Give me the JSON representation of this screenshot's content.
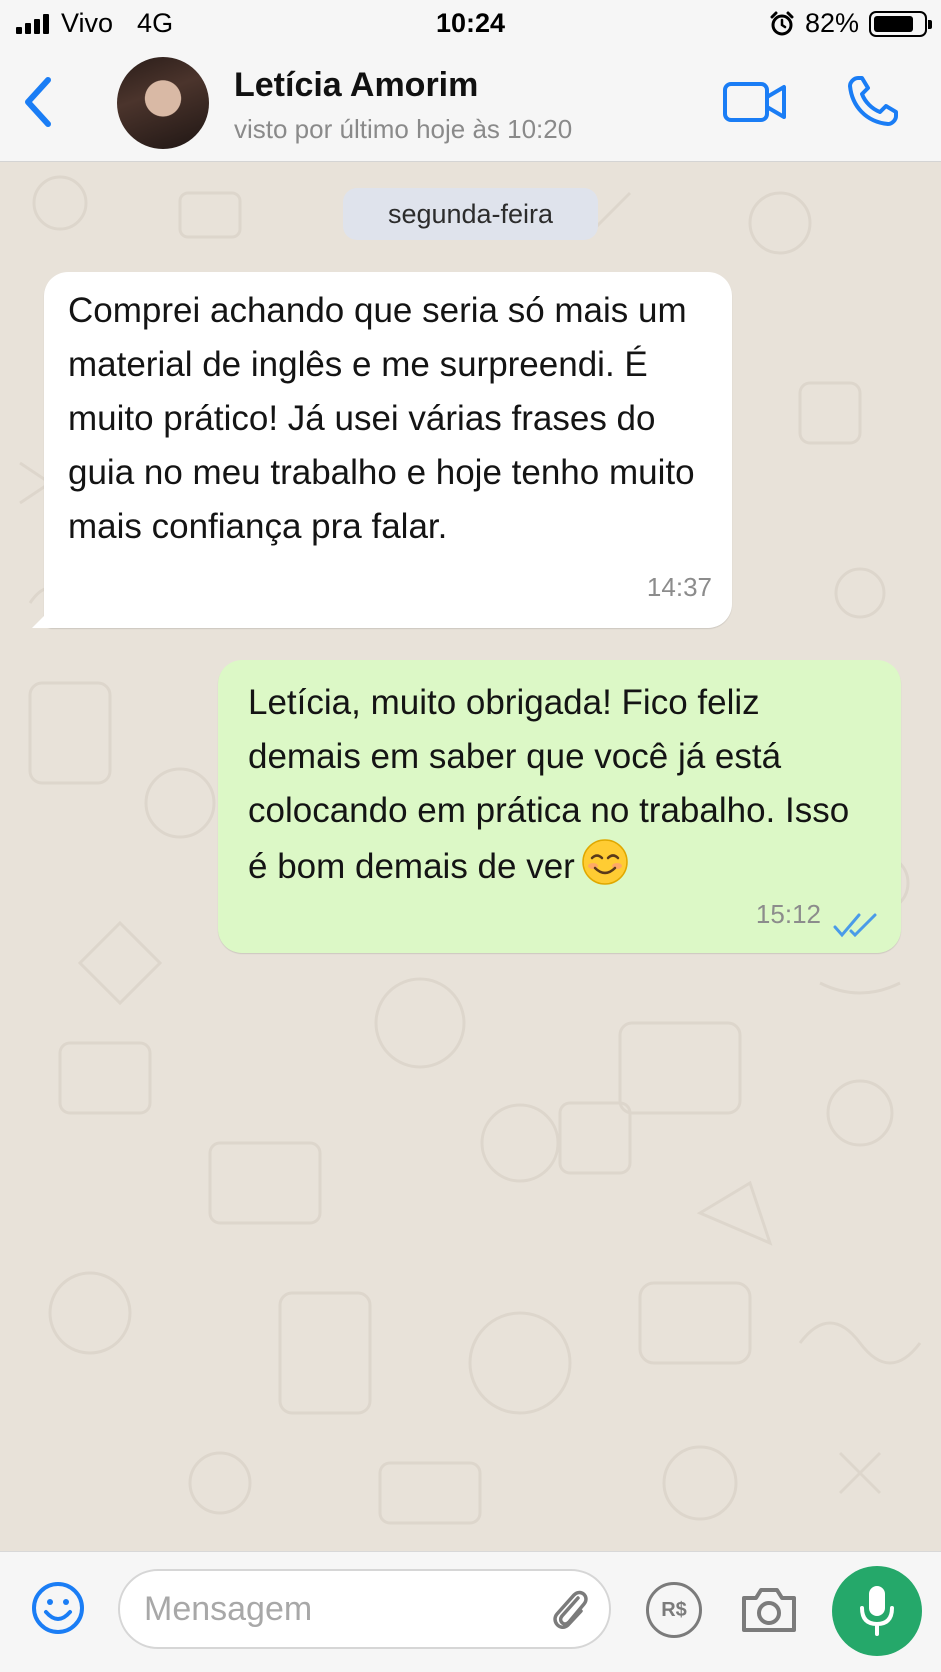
{
  "status_bar": {
    "carrier": "Vivo",
    "network": "4G",
    "time": "10:24",
    "battery_percent": "82%",
    "battery_level": 0.82,
    "icons": [
      "signal-icon",
      "alarm-icon",
      "battery-icon"
    ]
  },
  "header": {
    "contact_name": "Letícia Amorim",
    "last_seen": "visto por último hoje às 10:20",
    "icons": [
      "back-chevron-icon",
      "avatar",
      "video-call-icon",
      "phone-call-icon"
    ]
  },
  "chat": {
    "date_label": "segunda-feira",
    "messages": [
      {
        "direction": "incoming",
        "text": "Comprei achando que seria só mais um material de inglês e me surpreendi. É muito prático! Já usei várias frases do guia no meu trabalho e hoje tenho muito mais confiança pra falar.",
        "time": "14:37"
      },
      {
        "direction": "outgoing",
        "text": "Letícia, muito obrigada! Fico feliz demais em saber que você já está colocando em prática no trabalho. Isso é bom demais de ver",
        "emoji": "smiling-face-icon",
        "time": "15:12",
        "status": "read"
      }
    ]
  },
  "input_bar": {
    "placeholder": "Mensagem",
    "value": "",
    "payment_label": "R$",
    "icons": [
      "emoji-icon",
      "attachment-clip-icon",
      "payment-icon",
      "camera-icon",
      "microphone-icon"
    ]
  },
  "colors": {
    "accent_blue": "#1a7df5",
    "outgoing_bubble": "#dcf8c6",
    "incoming_bubble": "#ffffff",
    "chat_background": "#e8e2d9",
    "mic_button": "#25a86a",
    "read_ticks": "#4a9be8"
  }
}
